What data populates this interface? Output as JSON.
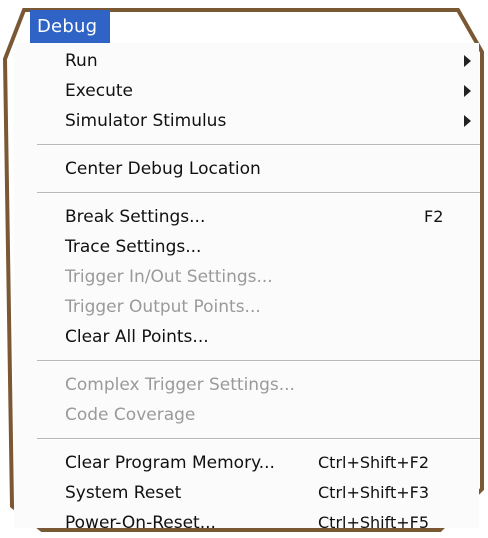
{
  "menu": {
    "title": "Debug",
    "items": [
      {
        "label": "Run",
        "submenu": true
      },
      {
        "label": "Execute",
        "submenu": true
      },
      {
        "label": "Simulator Stimulus",
        "submenu": true
      },
      {
        "separator": true
      },
      {
        "label": "Center Debug Location"
      },
      {
        "separator": true
      },
      {
        "label": "Break Settings...",
        "shortcut": "F2"
      },
      {
        "label": "Trace Settings..."
      },
      {
        "label": "Trigger In/Out Settings...",
        "disabled": true
      },
      {
        "label": "Trigger Output Points...",
        "disabled": true
      },
      {
        "label": "Clear All Points..."
      },
      {
        "separator": true
      },
      {
        "label": "Complex Trigger Settings...",
        "disabled": true
      },
      {
        "label": "Code Coverage",
        "disabled": true
      },
      {
        "separator": true
      },
      {
        "label": "Clear Program Memory...",
        "shortcut": "Ctrl+Shift+F2"
      },
      {
        "label": "System Reset",
        "shortcut": "Ctrl+Shift+F3"
      },
      {
        "label": "Power-On-Reset...",
        "shortcut": "Ctrl+Shift+F5"
      }
    ]
  },
  "colors": {
    "title_background": "#2f63c6",
    "frame_outline": "#7a5833",
    "disabled_text": "#9a9a9a"
  }
}
